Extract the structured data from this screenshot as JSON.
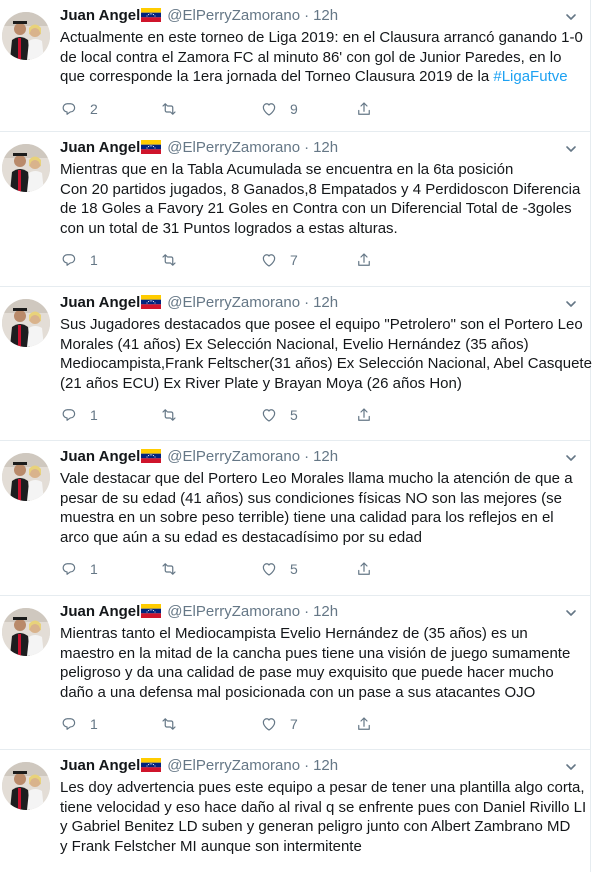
{
  "author": {
    "name": "Juan Angel",
    "handle": "@ElPerryZamorano",
    "separator": "·",
    "time": "12h"
  },
  "colors": {
    "link": "#1da1f2",
    "secondary": "#657786",
    "border": "#e6ecf0",
    "flag_yellow": "#ffcc00",
    "flag_blue": "#00247d",
    "flag_red": "#cf142b"
  },
  "icons": {
    "reply": "reply-icon",
    "retweet": "retweet-icon",
    "like": "like-icon",
    "share": "share-icon",
    "more": "chevron-down-icon",
    "flag": "venezuela-flag-icon"
  },
  "tweets": [
    {
      "lines": [
        "Actualmente en este torneo de Liga 2019: en el Clausura arrancó ganando 1-0",
        "de local contra el Zamora FC al minuto 86' con gol de Junior Paredes, en lo",
        "que corresponde la 1era jornada del Torneo Clausura 2019 de la "
      ],
      "hashtag": "#LigaFutve",
      "replies": "2",
      "retweets": "",
      "likes": "9"
    },
    {
      "lines": [
        "Mientras que en la Tabla Acumulada se encuentra en la 6ta posición",
        "Con 20 partidos jugados, 8 Ganados,8 Empatados y 4 Perdidoscon Diferencia",
        "de 18 Goles a Favory 21 Goles en Contra con un Diferencial Total de -3goles",
        "con un total de 31 Puntos logrados a estas alturas."
      ],
      "replies": "1",
      "retweets": "",
      "likes": "7"
    },
    {
      "lines": [
        "Sus Jugadores destacados que posee el equipo \"Petrolero\" son el Portero Leo",
        "Morales (41 años) Ex Selección Nacional, Evelio Hernández (35 años)",
        "Mediocampista,Frank Feltscher(31 años) Ex Selección Nacional, Abel Casquete",
        "(21 años ECU) Ex River Plate y Brayan Moya (26 años Hon)"
      ],
      "replies": "1",
      "retweets": "",
      "likes": "5"
    },
    {
      "lines": [
        "Vale destacar que del Portero Leo Morales llama mucho la atención de que a",
        "pesar de su edad (41 años) sus condiciones físicas NO son las mejores (se",
        "muestra en un sobre peso terrible) tiene una calidad para los reflejos en el",
        "arco que aún a su edad es destacadísimo por su edad"
      ],
      "replies": "1",
      "retweets": "",
      "likes": "5"
    },
    {
      "lines": [
        "Mientras tanto el Mediocampista Evelio Hernández de (35 años) es un",
        "maestro en la mitad de la cancha pues tiene una visión de juego sumamente",
        "peligroso y da una calidad de pase muy exquisito que puede hacer mucho",
        "daño a una defensa mal posicionada con un pase a sus atacantes OJO"
      ],
      "replies": "1",
      "retweets": "",
      "likes": "7"
    },
    {
      "lines": [
        "Les doy advertencia pues este equipo a pesar de tener una plantilla algo corta,",
        "tiene velocidad y eso hace daño al rival q se enfrente pues con Daniel Rivillo LI",
        "y Gabriel Benitez LD suben y generan peligro junto con Albert Zambrano MD",
        "y Frank Felstcher MI aunque son intermitente"
      ],
      "replies": "",
      "retweets": "",
      "likes": ""
    }
  ]
}
